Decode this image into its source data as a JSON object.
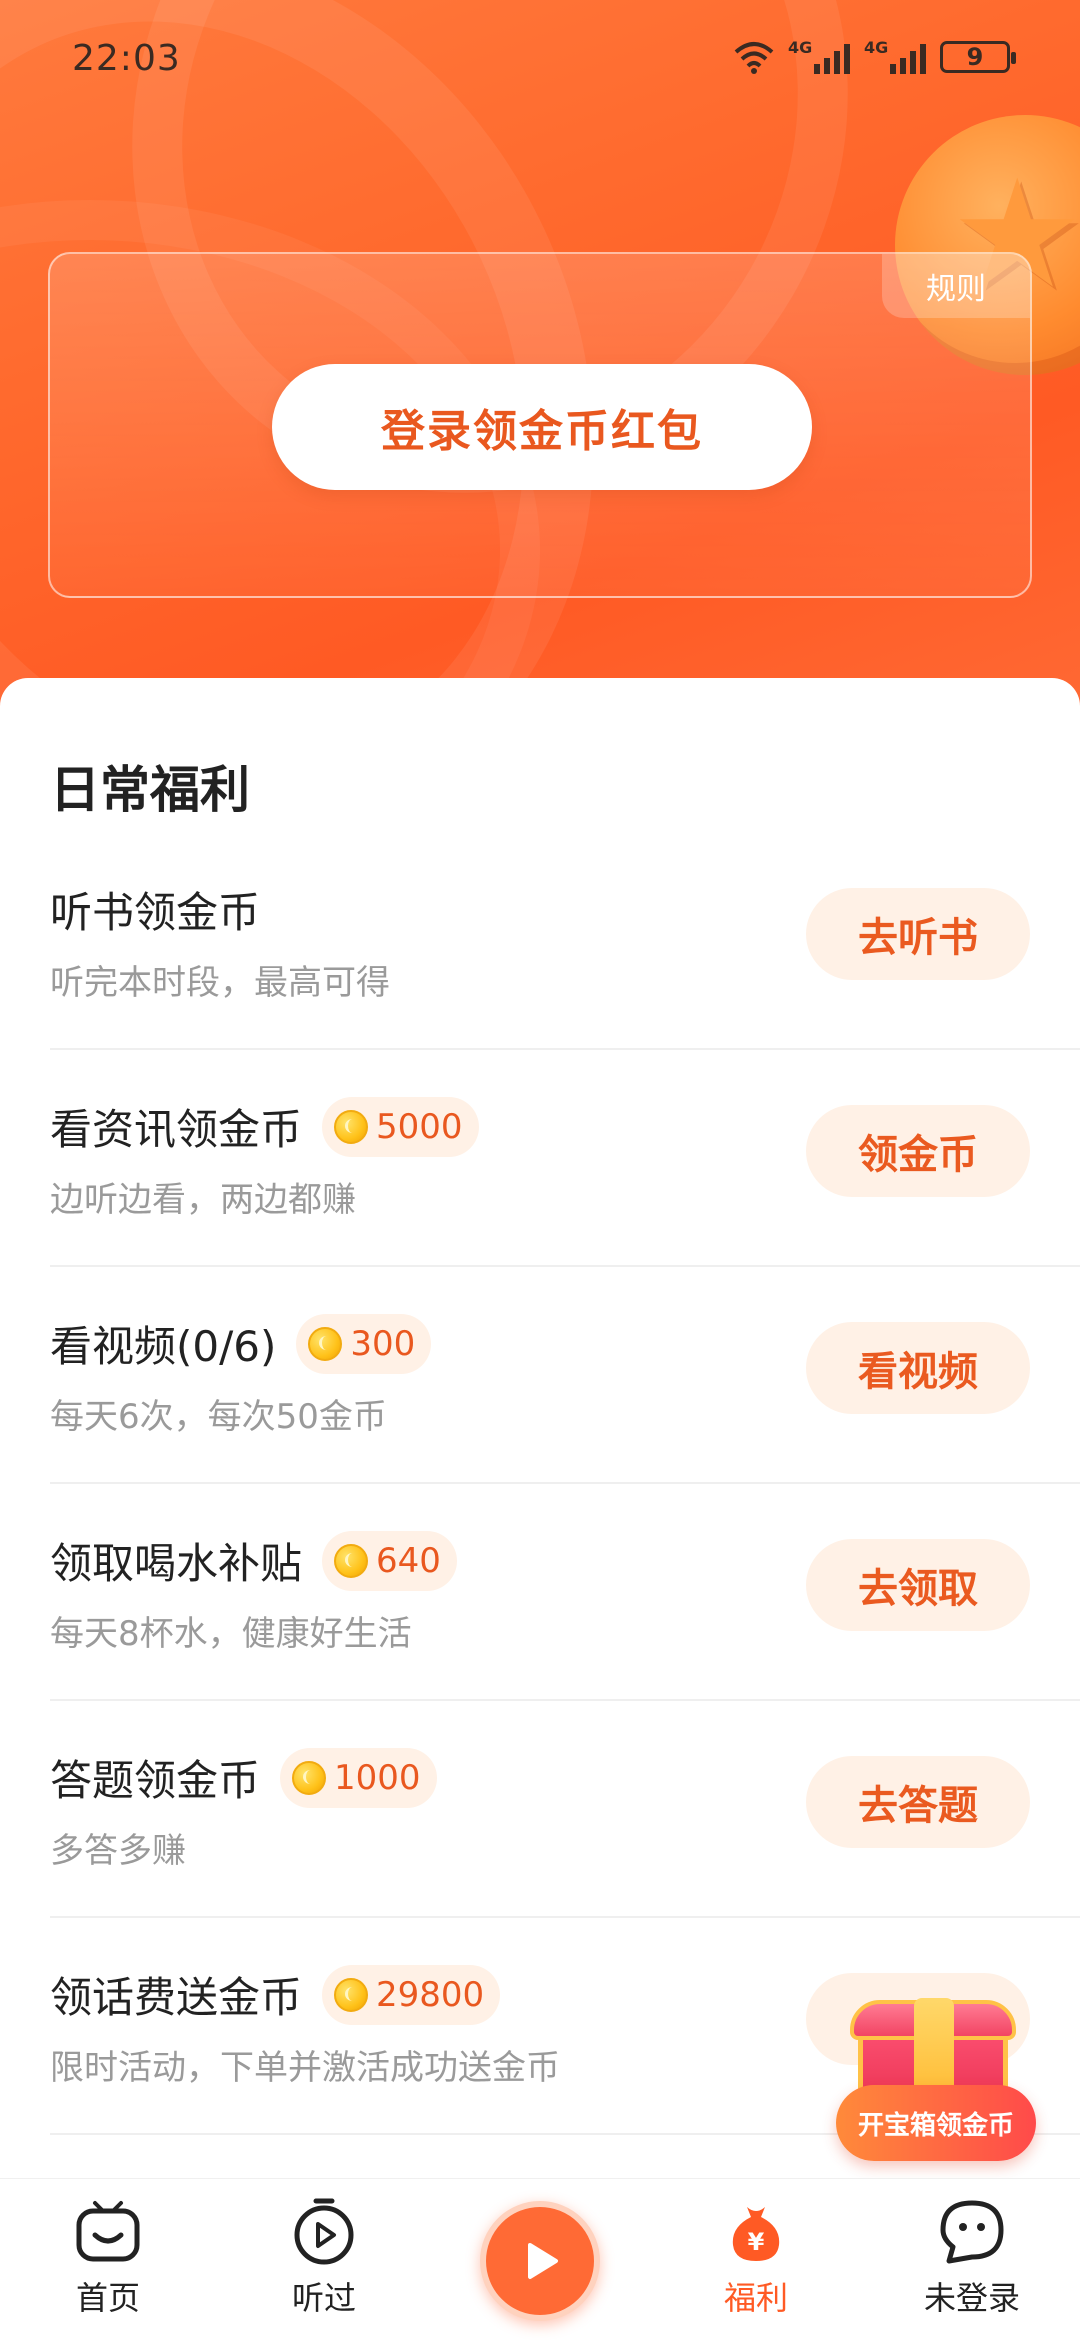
{
  "status_bar": {
    "time": "22:03",
    "net1": "4G",
    "net2": "4G",
    "battery": "9"
  },
  "header": {
    "rules_label": "规则",
    "login_label": "登录领金币红包"
  },
  "daily": {
    "title": "日常福利",
    "tasks": [
      {
        "title": "听书领金币",
        "coins": "",
        "subtitle": "听完本时段，最高可得",
        "button": "去听书"
      },
      {
        "title": "看资讯领金币",
        "coins": "5000",
        "subtitle": "边听边看，两边都赚",
        "button": "领金币"
      },
      {
        "title": "看视频(0/6)",
        "coins": "300",
        "subtitle": "每天6次，每次50金币",
        "button": "看视频"
      },
      {
        "title": "领取喝水补贴",
        "coins": "640",
        "subtitle": "每天8杯水，健康好生活",
        "button": "去领取"
      },
      {
        "title": "答题领金币",
        "coins": "1000",
        "subtitle": "多答多赚",
        "button": "去答题"
      },
      {
        "title": "领话费送金币",
        "coins": "29800",
        "subtitle": "限时活动，下单并激活成功送金币",
        "button": ""
      }
    ]
  },
  "chest": {
    "label": "开宝箱领金币"
  },
  "nav": {
    "items": [
      {
        "label": "首页"
      },
      {
        "label": "听过"
      },
      {
        "label": "福利"
      },
      {
        "label": "未登录"
      }
    ]
  },
  "colors": {
    "accent": "#ff5a24",
    "button_text": "#ea5a20",
    "button_bg": "#fff1e6"
  }
}
